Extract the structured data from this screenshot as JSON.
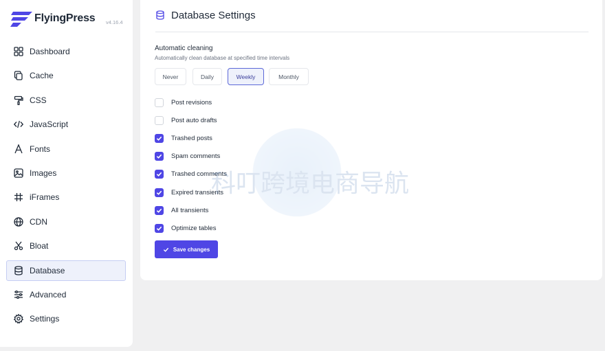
{
  "brand": {
    "name": "FlyingPress",
    "version": "v4.16.4",
    "color": "#4f46e5"
  },
  "sidebar": {
    "items": [
      {
        "label": "Dashboard",
        "icon": "grid-icon",
        "active": false
      },
      {
        "label": "Cache",
        "icon": "copy-icon",
        "active": false
      },
      {
        "label": "CSS",
        "icon": "paint-roller-icon",
        "active": false
      },
      {
        "label": "JavaScript",
        "icon": "code-icon",
        "active": false
      },
      {
        "label": "Fonts",
        "icon": "font-icon",
        "active": false
      },
      {
        "label": "Images",
        "icon": "image-icon",
        "active": false
      },
      {
        "label": "iFrames",
        "icon": "hash-icon",
        "active": false
      },
      {
        "label": "CDN",
        "icon": "globe-icon",
        "active": false
      },
      {
        "label": "Bloat",
        "icon": "scissors-icon",
        "active": false
      },
      {
        "label": "Database",
        "icon": "database-icon",
        "active": true
      },
      {
        "label": "Advanced",
        "icon": "sliders-icon",
        "active": false
      },
      {
        "label": "Settings",
        "icon": "gear-icon",
        "active": false
      }
    ]
  },
  "panel": {
    "title": "Database Settings",
    "icon": "database-icon",
    "auto_cleaning": {
      "title": "Automatic cleaning",
      "description": "Automatically clean database at specified time intervals",
      "options": [
        "Never",
        "Daily",
        "Weekly",
        "Monthly"
      ],
      "selected": "Weekly"
    },
    "checkboxes": [
      {
        "label": "Post revisions",
        "checked": false
      },
      {
        "label": "Post auto drafts",
        "checked": false
      },
      {
        "label": "Trashed posts",
        "checked": true
      },
      {
        "label": "Spam comments",
        "checked": true
      },
      {
        "label": "Trashed comments",
        "checked": true
      },
      {
        "label": "Expired transients",
        "checked": true
      },
      {
        "label": "All transients",
        "checked": true
      },
      {
        "label": "Optimize tables",
        "checked": true
      }
    ],
    "save_label": "Save changes"
  },
  "watermark": {
    "text": "科叮跨境电商导航"
  },
  "colors": {
    "accent": "#4f46e5",
    "active_bg": "#eef1fb",
    "page_bg": "#f0f0f1"
  }
}
